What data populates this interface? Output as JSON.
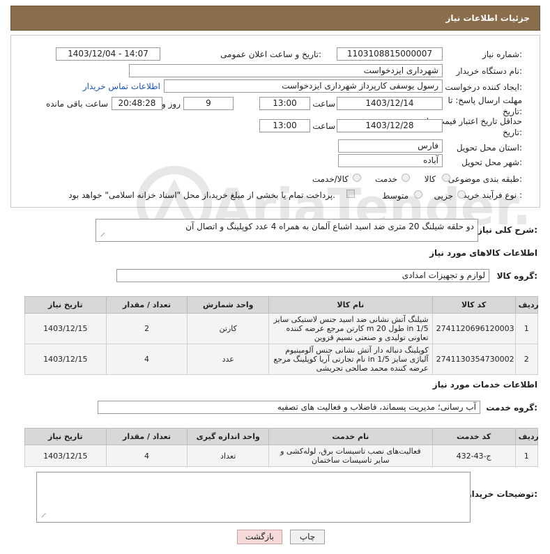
{
  "header": {
    "title": "جزئیات اطلاعات نیاز"
  },
  "form": {
    "need_number_label": "شماره نیاز:",
    "need_number": "1103108815000007",
    "announce_label": "تاریخ و ساعت اعلان عمومی:",
    "announce_value": "1403/12/04 - 14:07",
    "buyer_org_label": "نام دستگاه خریدار:",
    "buyer_org": "شهرداری ایزدخواست",
    "creator_label": "ایجاد کننده درخواست:",
    "creator": "رسول یوسفی کارپرداز شهرداری ایزدخواست",
    "contact_link": "اطلاعات تماس خریدار",
    "deadline_label": "مهلت ارسال پاسخ: تا تاریخ:",
    "deadline_date": "1403/12/14",
    "time_label": "ساعت",
    "deadline_time": "13:00",
    "days_value": "9",
    "days_label": "روز و",
    "remaining_time": "20:48:28",
    "remaining_label": "ساعت باقی مانده",
    "validity_label": "حداقل تاریخ اعتبار قیمت: تا تاریخ:",
    "validity_date": "1403/12/28",
    "validity_time": "13:00",
    "province_label": "استان محل تحویل:",
    "province": "فارس",
    "city_label": "شهر محل تحویل:",
    "city": "آباده",
    "category_label": "طبقه بندی موضوعی:",
    "category_options": [
      "کالا",
      "خدمت",
      "کالا/خدمت"
    ],
    "purchase_type_label": "نوع فرآیند خرید :",
    "purchase_options": [
      "جزیی",
      "متوسط"
    ],
    "purchase_note": "پرداخت تمام یا بخشی از مبلغ خرید،از محل \"اسناد خزانه اسلامی\" خواهد بود."
  },
  "summary": {
    "label": "شرح کلی نیاز:",
    "text": "دو حلقه شیلنگ 20 متری ضد اسید اشباع آلمان به همراه 4 عدد کوپلینگ و اتصال آن"
  },
  "goods": {
    "section_title": "اطلاعات کالاهای مورد نیاز",
    "group_label": "گروه کالا:",
    "group_value": "لوازم و تجهیزات امدادی",
    "columns": [
      "ردیف",
      "کد کالا",
      "نام کالا",
      "واحد شمارش",
      "تعداد / مقدار",
      "تاریخ نیاز"
    ],
    "rows": [
      {
        "index": "1",
        "code": "2741120696120003",
        "name": "شیلنگ آتش نشانی ضد اسید جنس لاستیکی سایز in 1/5 طول m 20 کارتن مرجع عرضه کننده تعاونی تولیدی و صنعتی نسیم قزوین",
        "unit": "کارتن",
        "qty": "2",
        "date": "1403/12/15"
      },
      {
        "index": "2",
        "code": "2741130354730002",
        "name": "کوپلینگ دنباله دار آتش نشانی جنس آلومینیوم آلیاژی سایز 1/5 in نام تجارتی آریا کوپلینگ مرجع عرضه کننده محمد صالحی تجریشی",
        "unit": "عدد",
        "qty": "4",
        "date": "1403/12/15"
      }
    ]
  },
  "services": {
    "section_title": "اطلاعات خدمات مورد نیاز",
    "group_label": "گروه خدمت:",
    "group_value": "آب رسانی؛ مدیریت پسماند، فاضلاب و فعالیت های تصفیه",
    "columns": [
      "ردیف",
      "کد خدمت",
      "نام خدمت",
      "واحد اندازه گیری",
      "تعداد / مقدار",
      "تاریخ نیاز"
    ],
    "rows": [
      {
        "index": "1",
        "code": "ج-43-432",
        "name": "فعالیت‌های نصب تاسیسات برق، لوله‌کشی و سایر تاسیسات ساختمان",
        "unit": "تعداد",
        "qty": "4",
        "date": "1403/12/15"
      }
    ]
  },
  "buyer_notes": {
    "label": "توضیحات خریدار:",
    "text": ""
  },
  "buttons": {
    "print": "چاپ",
    "back": "بازگشت"
  },
  "watermark": {
    "text": "AriaTender.neT"
  },
  "colors": {
    "header_bg": "#8a6e4b",
    "link": "#1a56b8",
    "back_button_bg": "#f6d9d9"
  }
}
